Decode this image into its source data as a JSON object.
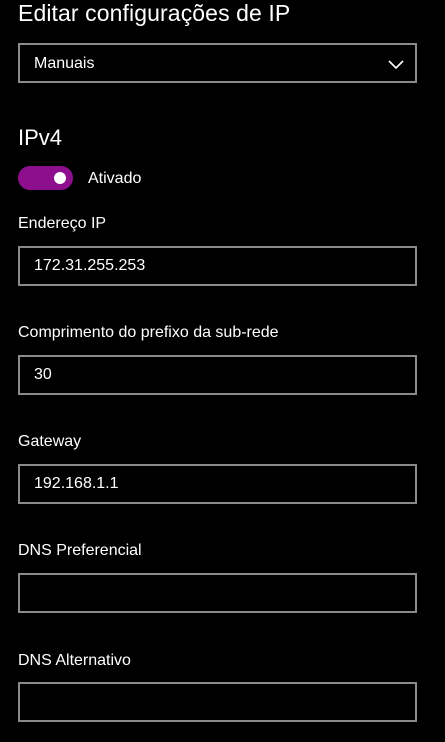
{
  "dialog": {
    "title": "Editar configurações de IP"
  },
  "mode_select": {
    "value": "Manuais",
    "icon": "chevron-down-icon"
  },
  "ipv4": {
    "section_title": "IPv4",
    "toggle": {
      "state": "on",
      "label": "Ativado",
      "accent_color": "#8e0f8e"
    },
    "fields": {
      "ip_address": {
        "label": "Endereço IP",
        "value": "172.31.255.253"
      },
      "subnet_prefix": {
        "label": "Comprimento do prefixo da sub-rede",
        "value": "30"
      },
      "gateway": {
        "label": "Gateway",
        "value": "192.168.1.1"
      },
      "dns_preferred": {
        "label": "DNS Preferencial",
        "value": ""
      },
      "dns_alternate": {
        "label": "DNS Alternativo",
        "value": ""
      }
    }
  },
  "colors": {
    "background": "#000000",
    "text": "#ffffff",
    "input_border": "#8a8a8a"
  }
}
